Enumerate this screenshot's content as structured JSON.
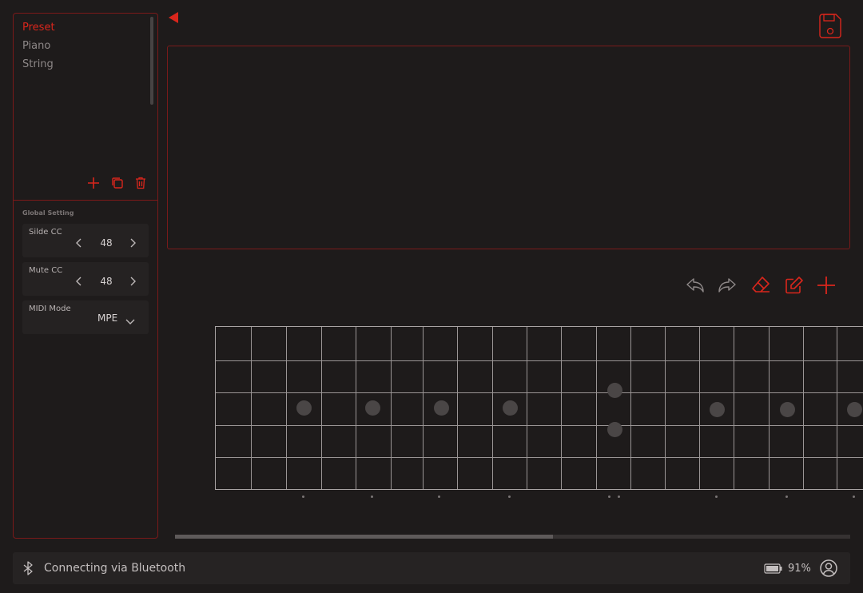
{
  "sidebar": {
    "presets": [
      {
        "label": "Preset",
        "active": true
      },
      {
        "label": "Piano",
        "active": false
      },
      {
        "label": "String",
        "active": false
      }
    ],
    "actions": {
      "add_icon": "plus-icon",
      "duplicate_icon": "copy-icon",
      "delete_icon": "trash-icon"
    }
  },
  "global_setting": {
    "title": "Global Setting",
    "slide_cc": {
      "label": "Silde CC",
      "value": "48"
    },
    "mute_cc": {
      "label": "Mute CC",
      "value": "48"
    },
    "midi_mode": {
      "label": "MIDI Mode",
      "value": "MPE"
    }
  },
  "toolbar": {
    "icons": [
      "undo-icon",
      "redo-icon",
      "eraser-icon",
      "edit-icon",
      "plus-icon"
    ]
  },
  "fretboard": {
    "frets": 19,
    "strings": 6,
    "scroll_progress": 0.56
  },
  "status": {
    "connection": "Connecting via Bluetooth",
    "battery": "91%"
  },
  "colors": {
    "accent": "#d9261c",
    "panel_border": "#7a1a1a",
    "background": "#1e1b1b"
  }
}
